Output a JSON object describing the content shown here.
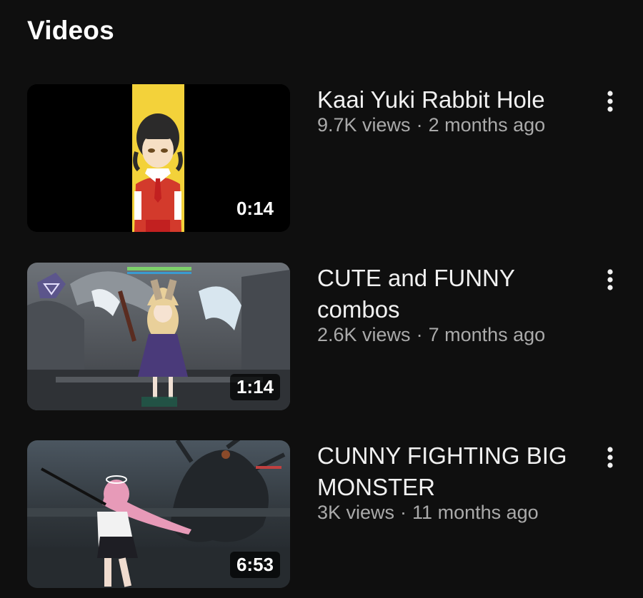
{
  "section": {
    "title": "Videos"
  },
  "videos": [
    {
      "title": "Kaai Yuki Rabbit Hole",
      "views": "9.7K views",
      "age": "2 months ago",
      "duration": "0:14",
      "thumbnail_icon": "anime-girl-portrait-thumbnail"
    },
    {
      "title": "CUTE and FUNNY combos",
      "views": "2.6K views",
      "age": "7 months ago",
      "duration": "1:14",
      "thumbnail_icon": "game-castle-scene-thumbnail"
    },
    {
      "title": "CUNNY FIGHTING BIG MONSTER",
      "views": "3K views",
      "age": "11 months ago",
      "duration": "6:53",
      "thumbnail_icon": "game-monster-battle-thumbnail"
    }
  ],
  "colors": {
    "background": "#0f0f0f",
    "title_text": "#f1f1f1",
    "meta_text": "#aaaaaa",
    "thumb1_accent": "#f3d23a",
    "thumb3_accent": "#e79ab8"
  }
}
